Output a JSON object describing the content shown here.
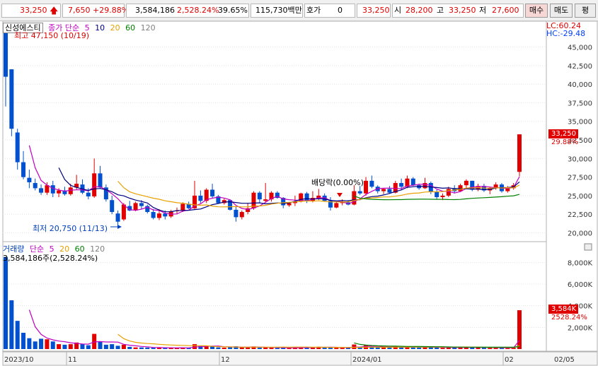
{
  "quote": {
    "price": "33,250",
    "change": "7,650",
    "change_pct": "+29.88%",
    "volume": "3,584,186",
    "volume_ratio": "2,528.24%",
    "turnover_rate": "39.65%",
    "amount": "115,730백만",
    "quote_label": "호가",
    "quote_value": "0",
    "current_price": "33,250",
    "open_label": "시",
    "open_value": "28,200",
    "high_label": "고",
    "high_value": "33,250",
    "low_label": "저",
    "low_value": "27,600",
    "buy_label": "매수",
    "sell_label": "매도",
    "extra_label": "평"
  },
  "price_panel": {
    "stock_name": "신성에스티",
    "legend_label": "종가 단순",
    "ma_periods": [
      "5",
      "10",
      "20",
      "60",
      "120"
    ],
    "ma_colors": [
      "#c000c0",
      "#000080",
      "#e8a000",
      "#008000",
      "#808080"
    ],
    "high_annotation": "최고 47,150 (10/19)",
    "low_annotation": "최저 20,750 (11/13)",
    "dividend_annotation": "배당락(0.00%)",
    "lc": "LC:60.24",
    "hc": "HC:-29.48",
    "last_price_tag": "33,250",
    "last_pct": "29.88%"
  },
  "volume_panel": {
    "title": "거래량",
    "legend_label": "단순",
    "ma_periods": [
      "5",
      "20",
      "60",
      "120"
    ],
    "current_volume": "3,584,186주(2,528.24%)",
    "last_volume_tag": "3,584K",
    "last_volume_pct": "2528.24%"
  },
  "x_labels": [
    "2023/10",
    "11",
    "12",
    "2024/01",
    "02",
    "02/05"
  ],
  "chart_data": {
    "type": "candlestick",
    "title": "신성에스티",
    "price_axis": {
      "ticks": [
        20000,
        22500,
        25000,
        27500,
        30000,
        32500,
        35000,
        37500,
        40000,
        42500,
        45000
      ],
      "range": [
        19000,
        48000
      ]
    },
    "volume_axis": {
      "ticks": [
        "2,000K",
        "4,000K",
        "6,000K",
        "8,000K"
      ],
      "range": [
        0,
        9000000
      ]
    },
    "candles": [
      {
        "o": 47150,
        "h": 47150,
        "l": 37000,
        "c": 41000,
        "v": 8500000
      },
      {
        "o": 42000,
        "h": 42000,
        "l": 33000,
        "c": 34000,
        "v": 4500000
      },
      {
        "o": 33500,
        "h": 34000,
        "l": 28500,
        "c": 29500,
        "v": 2600000
      },
      {
        "o": 29500,
        "h": 31000,
        "l": 27200,
        "c": 27500,
        "v": 1500000
      },
      {
        "o": 27400,
        "h": 28500,
        "l": 26000,
        "c": 26800,
        "v": 1000000
      },
      {
        "o": 26700,
        "h": 27300,
        "l": 25700,
        "c": 26000,
        "v": 700000
      },
      {
        "o": 26000,
        "h": 26500,
        "l": 25100,
        "c": 25400,
        "v": 950000
      },
      {
        "o": 25400,
        "h": 26800,
        "l": 25100,
        "c": 26400,
        "v": 900000
      },
      {
        "o": 26400,
        "h": 27000,
        "l": 24800,
        "c": 25300,
        "v": 700000
      },
      {
        "o": 25300,
        "h": 26000,
        "l": 24800,
        "c": 25700,
        "v": 450000
      },
      {
        "o": 25700,
        "h": 26200,
        "l": 25000,
        "c": 25200,
        "v": 400000
      },
      {
        "o": 25200,
        "h": 26600,
        "l": 25000,
        "c": 26100,
        "v": 450000
      },
      {
        "o": 26100,
        "h": 27800,
        "l": 25800,
        "c": 26600,
        "v": 600000
      },
      {
        "o": 26500,
        "h": 27200,
        "l": 25200,
        "c": 25400,
        "v": 450000
      },
      {
        "o": 25400,
        "h": 26000,
        "l": 24500,
        "c": 24900,
        "v": 350000
      },
      {
        "o": 24900,
        "h": 30000,
        "l": 24700,
        "c": 28000,
        "v": 1400000
      },
      {
        "o": 28000,
        "h": 29000,
        "l": 25900,
        "c": 26100,
        "v": 650000
      },
      {
        "o": 26100,
        "h": 26500,
        "l": 24200,
        "c": 24500,
        "v": 400000
      },
      {
        "o": 24400,
        "h": 25000,
        "l": 22500,
        "c": 22800,
        "v": 450000
      },
      {
        "o": 22600,
        "h": 23000,
        "l": 20750,
        "c": 21500,
        "v": 300000
      },
      {
        "o": 21800,
        "h": 24000,
        "l": 21600,
        "c": 23800,
        "v": 400000
      },
      {
        "o": 23600,
        "h": 24300,
        "l": 22900,
        "c": 23000,
        "v": 200000
      },
      {
        "o": 23000,
        "h": 24200,
        "l": 22900,
        "c": 24000,
        "v": 150000
      },
      {
        "o": 24000,
        "h": 24400,
        "l": 23200,
        "c": 23600,
        "v": 150000
      },
      {
        "o": 23600,
        "h": 23800,
        "l": 22600,
        "c": 22800,
        "v": 140000
      },
      {
        "o": 22800,
        "h": 23200,
        "l": 21800,
        "c": 22000,
        "v": 120000
      },
      {
        "o": 22000,
        "h": 23200,
        "l": 21700,
        "c": 22600,
        "v": 110000
      },
      {
        "o": 22600,
        "h": 23000,
        "l": 21800,
        "c": 22200,
        "v": 100000
      },
      {
        "o": 22200,
        "h": 23100,
        "l": 22000,
        "c": 22900,
        "v": 130000
      },
      {
        "o": 22900,
        "h": 23400,
        "l": 22500,
        "c": 23000,
        "v": 100000
      },
      {
        "o": 23000,
        "h": 24100,
        "l": 22800,
        "c": 23900,
        "v": 140000
      },
      {
        "o": 23900,
        "h": 24200,
        "l": 23200,
        "c": 23300,
        "v": 100000
      },
      {
        "o": 23300,
        "h": 27000,
        "l": 23200,
        "c": 25000,
        "v": 450000
      },
      {
        "o": 25000,
        "h": 25700,
        "l": 24000,
        "c": 24300,
        "v": 280000
      },
      {
        "o": 24300,
        "h": 26000,
        "l": 24000,
        "c": 25800,
        "v": 270000
      },
      {
        "o": 25800,
        "h": 26600,
        "l": 24700,
        "c": 24900,
        "v": 260000
      },
      {
        "o": 24900,
        "h": 25100,
        "l": 23900,
        "c": 24000,
        "v": 150000
      },
      {
        "o": 24000,
        "h": 24600,
        "l": 23800,
        "c": 24400,
        "v": 130000
      },
      {
        "o": 24400,
        "h": 24500,
        "l": 23000,
        "c": 23100,
        "v": 180000
      },
      {
        "o": 23100,
        "h": 23500,
        "l": 21500,
        "c": 22100,
        "v": 250000
      },
      {
        "o": 22100,
        "h": 23000,
        "l": 21800,
        "c": 22800,
        "v": 150000
      },
      {
        "o": 22800,
        "h": 24000,
        "l": 22500,
        "c": 23300,
        "v": 140000
      },
      {
        "o": 23300,
        "h": 25600,
        "l": 23100,
        "c": 25400,
        "v": 240000
      },
      {
        "o": 25400,
        "h": 25600,
        "l": 24000,
        "c": 24500,
        "v": 130000
      },
      {
        "o": 24300,
        "h": 26700,
        "l": 24100,
        "c": 24500,
        "v": 140000
      },
      {
        "o": 24500,
        "h": 25600,
        "l": 24200,
        "c": 25400,
        "v": 120000
      },
      {
        "o": 25400,
        "h": 25600,
        "l": 24600,
        "c": 24700,
        "v": 100000
      },
      {
        "o": 24700,
        "h": 24800,
        "l": 23300,
        "c": 23700,
        "v": 150000
      },
      {
        "o": 23700,
        "h": 24100,
        "l": 23500,
        "c": 24000,
        "v": 90000
      },
      {
        "o": 24000,
        "h": 25000,
        "l": 23600,
        "c": 24200,
        "v": 150000
      },
      {
        "o": 24200,
        "h": 25400,
        "l": 24100,
        "c": 25300,
        "v": 120000
      },
      {
        "o": 25300,
        "h": 25500,
        "l": 24000,
        "c": 24300,
        "v": 160000
      },
      {
        "o": 24300,
        "h": 25600,
        "l": 24100,
        "c": 24700,
        "v": 190000
      },
      {
        "o": 24700,
        "h": 25900,
        "l": 24400,
        "c": 25000,
        "v": 210000
      },
      {
        "o": 25000,
        "h": 25300,
        "l": 24200,
        "c": 24300,
        "v": 140000
      },
      {
        "o": 24300,
        "h": 24800,
        "l": 23000,
        "c": 23400,
        "v": 160000
      },
      {
        "o": 23400,
        "h": 24200,
        "l": 23300,
        "c": 24000,
        "v": 120000
      },
      {
        "o": 24000,
        "h": 24500,
        "l": 23700,
        "c": 24100,
        "v": 100000
      },
      {
        "o": 24100,
        "h": 24400,
        "l": 23700,
        "c": 23800,
        "v": 110000
      },
      {
        "o": 23800,
        "h": 26400,
        "l": 23700,
        "c": 25600,
        "v": 420000
      },
      {
        "o": 25600,
        "h": 26300,
        "l": 25100,
        "c": 25300,
        "v": 180000
      },
      {
        "o": 25300,
        "h": 27500,
        "l": 25000,
        "c": 27000,
        "v": 390000
      },
      {
        "o": 27000,
        "h": 27700,
        "l": 26000,
        "c": 26200,
        "v": 200000
      },
      {
        "o": 26200,
        "h": 26400,
        "l": 25300,
        "c": 25600,
        "v": 150000
      },
      {
        "o": 25600,
        "h": 26000,
        "l": 25200,
        "c": 25900,
        "v": 130000
      },
      {
        "o": 25900,
        "h": 26300,
        "l": 25300,
        "c": 25400,
        "v": 140000
      },
      {
        "o": 25400,
        "h": 27000,
        "l": 25300,
        "c": 26700,
        "v": 230000
      },
      {
        "o": 26700,
        "h": 27300,
        "l": 25800,
        "c": 26200,
        "v": 180000
      },
      {
        "o": 26200,
        "h": 27700,
        "l": 26000,
        "c": 27300,
        "v": 200000
      },
      {
        "o": 27300,
        "h": 27500,
        "l": 26300,
        "c": 26400,
        "v": 150000
      },
      {
        "o": 26400,
        "h": 26600,
        "l": 25800,
        "c": 26000,
        "v": 140000
      },
      {
        "o": 26000,
        "h": 27400,
        "l": 25900,
        "c": 26700,
        "v": 190000
      },
      {
        "o": 26700,
        "h": 26900,
        "l": 25200,
        "c": 25500,
        "v": 170000
      },
      {
        "o": 25500,
        "h": 25800,
        "l": 24500,
        "c": 24800,
        "v": 150000
      },
      {
        "o": 24800,
        "h": 25300,
        "l": 24400,
        "c": 25000,
        "v": 110000
      },
      {
        "o": 25000,
        "h": 26200,
        "l": 24800,
        "c": 25900,
        "v": 160000
      },
      {
        "o": 25900,
        "h": 26400,
        "l": 25300,
        "c": 25600,
        "v": 130000
      },
      {
        "o": 25600,
        "h": 26600,
        "l": 25500,
        "c": 26400,
        "v": 170000
      },
      {
        "o": 26400,
        "h": 27200,
        "l": 25900,
        "c": 27000,
        "v": 190000
      },
      {
        "o": 27000,
        "h": 27000,
        "l": 25600,
        "c": 25800,
        "v": 160000
      },
      {
        "o": 25800,
        "h": 26600,
        "l": 25600,
        "c": 26300,
        "v": 130000
      },
      {
        "o": 26300,
        "h": 26600,
        "l": 25500,
        "c": 25700,
        "v": 120000
      },
      {
        "o": 25700,
        "h": 26200,
        "l": 25200,
        "c": 26000,
        "v": 110000
      },
      {
        "o": 26000,
        "h": 26800,
        "l": 25800,
        "c": 26500,
        "v": 140000
      },
      {
        "o": 26500,
        "h": 26700,
        "l": 25400,
        "c": 25600,
        "v": 100000
      },
      {
        "o": 25600,
        "h": 26300,
        "l": 25400,
        "c": 26000,
        "v": 90000
      },
      {
        "o": 26000,
        "h": 26700,
        "l": 25800,
        "c": 26400,
        "v": 120000
      },
      {
        "o": 28200,
        "h": 33250,
        "l": 27600,
        "c": 33250,
        "v": 3584186
      }
    ]
  }
}
